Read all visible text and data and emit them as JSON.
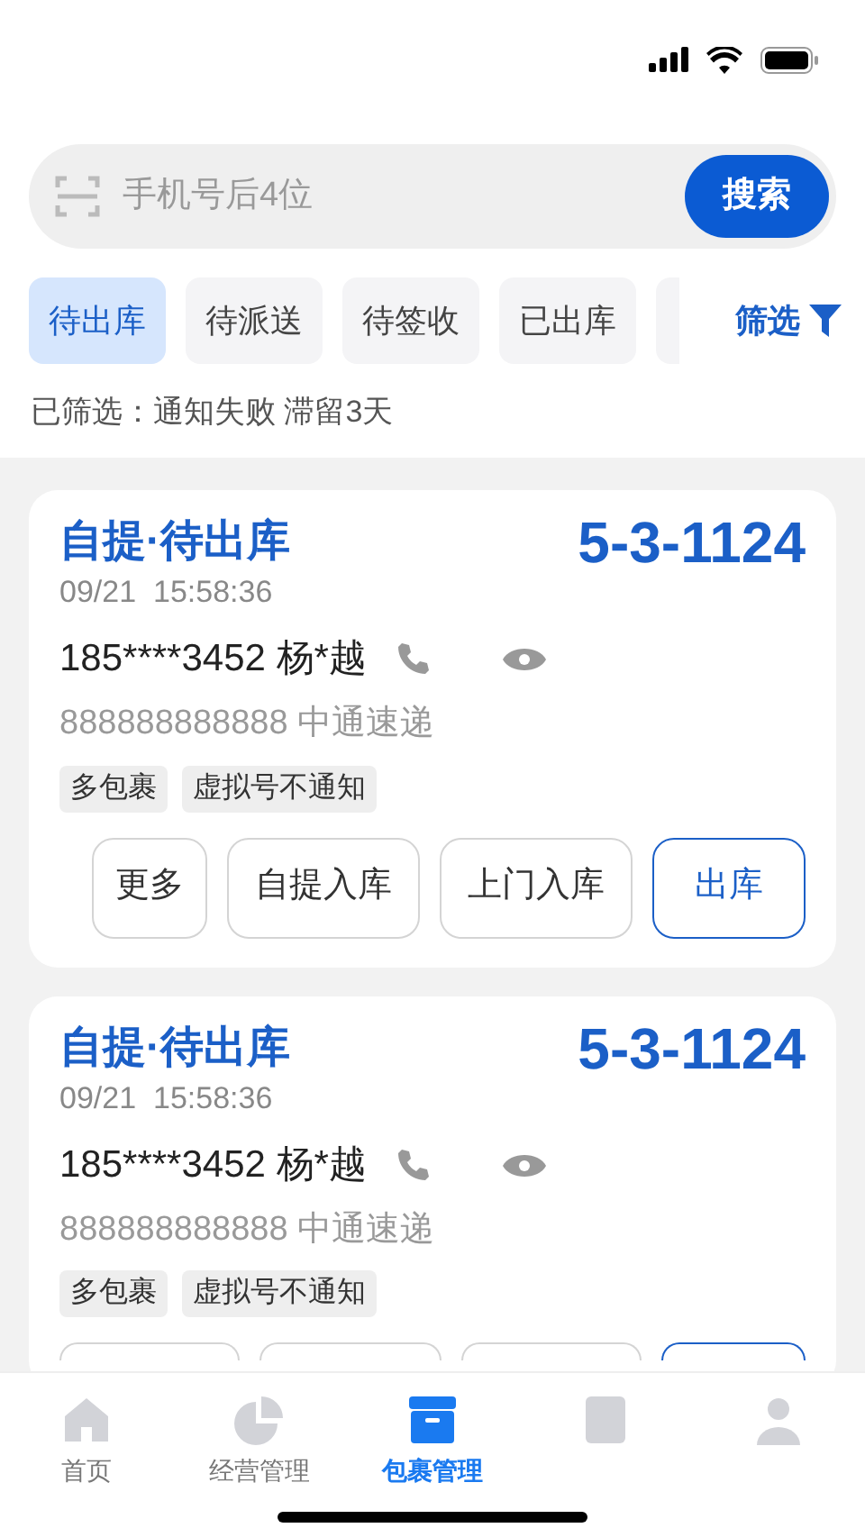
{
  "search": {
    "placeholder": "手机号后4位",
    "button": "搜索"
  },
  "tabs": [
    {
      "label": "待出库",
      "selected": true
    },
    {
      "label": "待派送",
      "selected": false
    },
    {
      "label": "待签收",
      "selected": false
    },
    {
      "label": "已出库",
      "selected": false
    },
    {
      "kind": "cut",
      "selected": false
    }
  ],
  "filter_button": "筛选",
  "filter_summary": "已筛选：通知失败 滞留3天",
  "cards": [
    {
      "status": "自提·待出库",
      "code": "5-3-1124",
      "time": "09/21  15:58:36",
      "phone": "185****3452 杨*越",
      "waybill": "888888888888 中通速递",
      "tags": [
        "多包裹",
        "虚拟号不通知"
      ],
      "actions": [
        {
          "label": "更多",
          "kind": "outline"
        },
        {
          "label": "自提入库",
          "kind": "outline"
        },
        {
          "label": "上门入库",
          "kind": "outline"
        },
        {
          "label": "出库",
          "kind": "primary"
        }
      ]
    },
    {
      "status": "自提·待出库",
      "code": "5-3-1124",
      "time": "09/21  15:58:36",
      "phone": "185****3452 杨*越",
      "waybill": "888888888888 中通速递",
      "tags": [
        "多包裹",
        "虚拟号不通知"
      ],
      "actions": [
        {
          "kind": "outline"
        },
        {
          "kind": "outline"
        },
        {
          "kind": "outline"
        },
        {
          "kind": "primary"
        }
      ]
    }
  ],
  "nav": [
    {
      "label": "首页",
      "selected": false
    },
    {
      "label": "经营管理",
      "selected": false
    },
    {
      "label": "包裹管理",
      "selected": true
    },
    {
      "selected": false
    },
    {
      "selected": false
    }
  ]
}
